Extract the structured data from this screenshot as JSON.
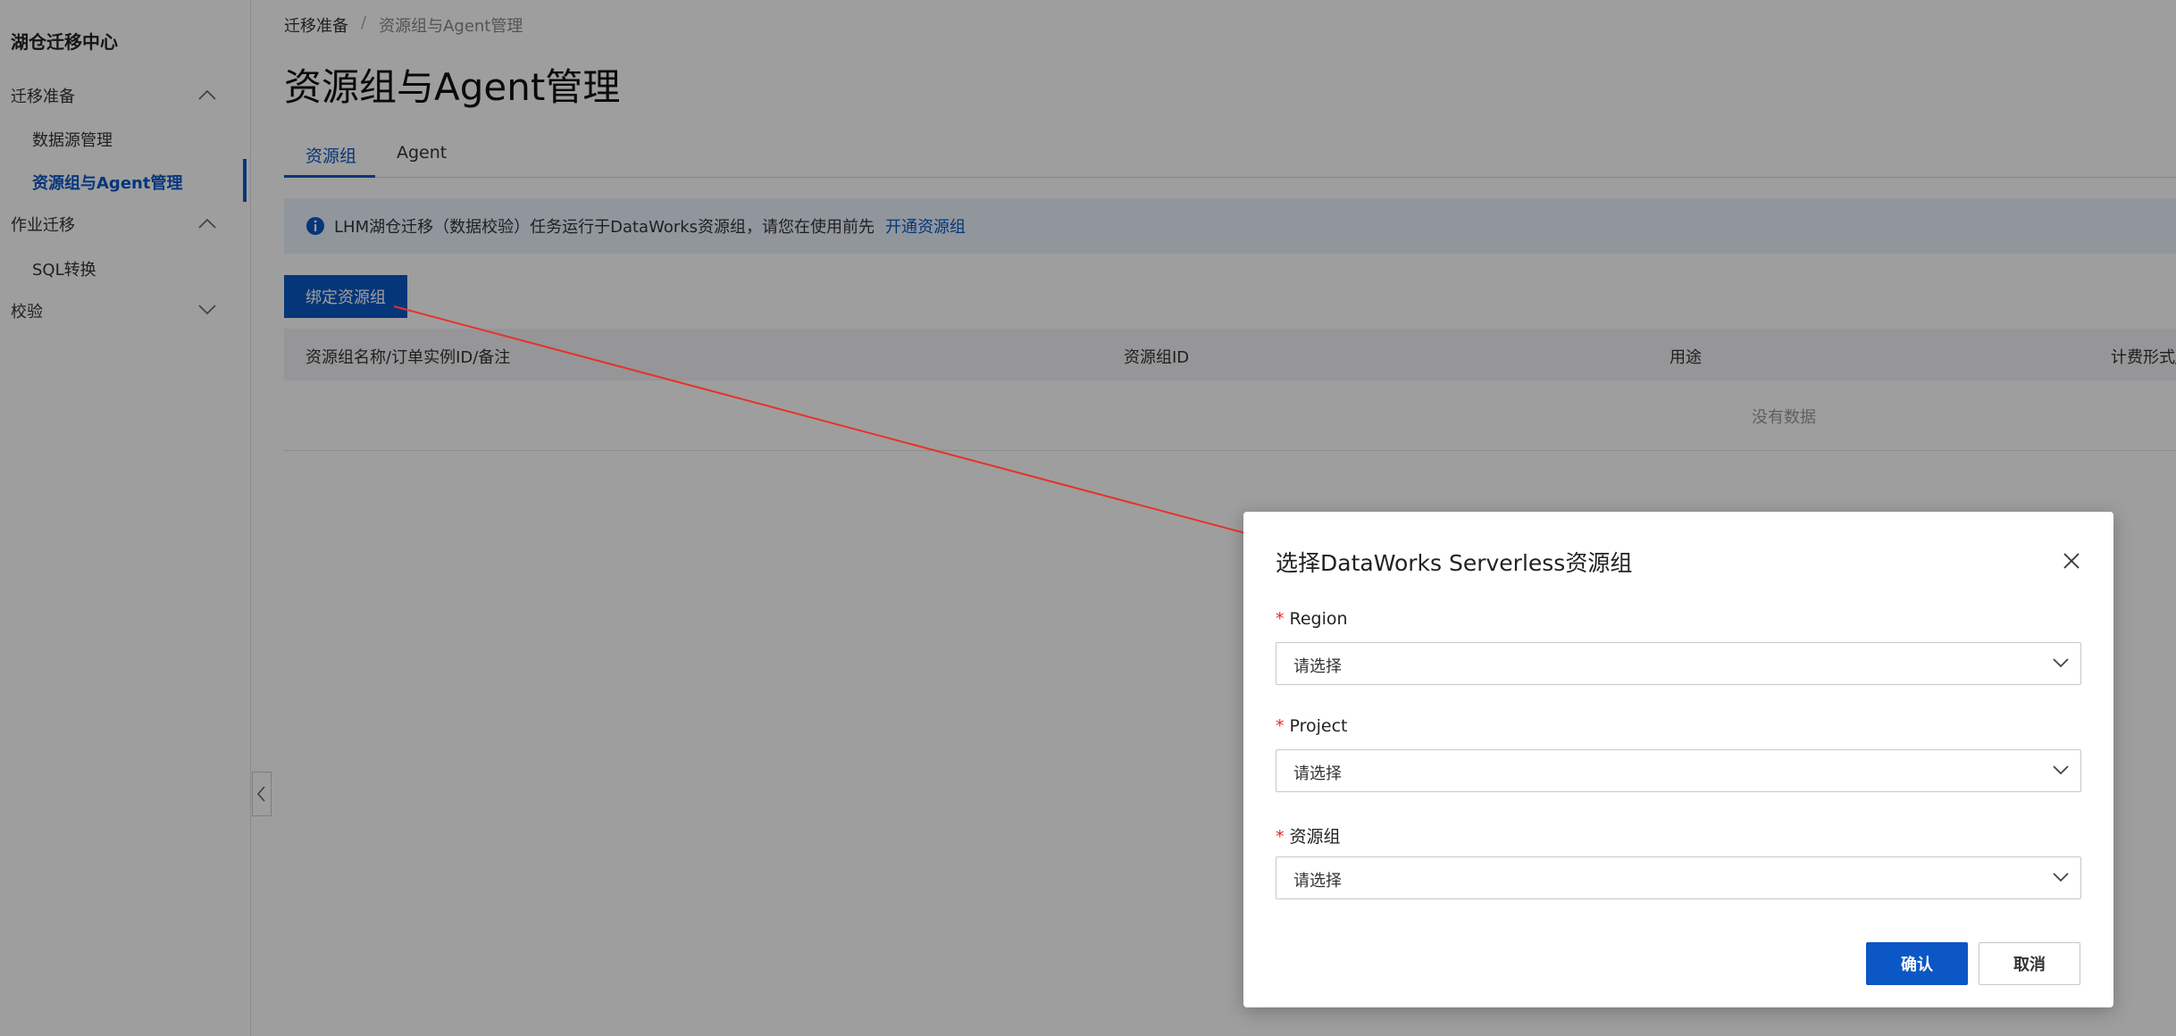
{
  "sidebar": {
    "brand": "湖仓迁移中心",
    "groups": [
      {
        "label": "迁移准备",
        "items": [
          "数据源管理",
          "资源组与Agent管理"
        ]
      },
      {
        "label": "作业迁移",
        "items": [
          "SQL转换"
        ]
      },
      {
        "label": "校验",
        "items": []
      }
    ],
    "active_item": "资源组与Agent管理"
  },
  "breadcrumb": {
    "parent": "迁移准备",
    "separator": "/",
    "current": "资源组与Agent管理"
  },
  "page_title": "资源组与Agent管理",
  "tabs": [
    {
      "label": "资源组",
      "active": true
    },
    {
      "label": "Agent",
      "active": false
    }
  ],
  "notice": {
    "text": "LHM湖仓迁移（数据校验）任务运行于DataWorks资源组，请您在使用前先",
    "link": "开通资源组"
  },
  "bind_button": "绑定资源组",
  "table": {
    "columns": [
      "资源组名称/订单实例ID/备注",
      "资源组ID",
      "用途",
      "计费形式/规格"
    ],
    "empty_text": "没有数据"
  },
  "dialog": {
    "title": "选择DataWorks Serverless资源组",
    "fields": [
      {
        "label": "Region",
        "required": true,
        "placeholder": "请选择"
      },
      {
        "label": "Project",
        "required": true,
        "placeholder": "请选择"
      },
      {
        "label": "资源组",
        "required": true,
        "placeholder": "请选择"
      }
    ],
    "confirm": "确认",
    "cancel": "取消"
  },
  "colors": {
    "primary": "#0b57c5",
    "required": "#e0282e",
    "annotation_arrow": "#e8312a"
  },
  "icons": [
    "chevron-up-icon",
    "chevron-down-icon",
    "info-icon",
    "close-icon",
    "collapse-left-icon"
  ]
}
